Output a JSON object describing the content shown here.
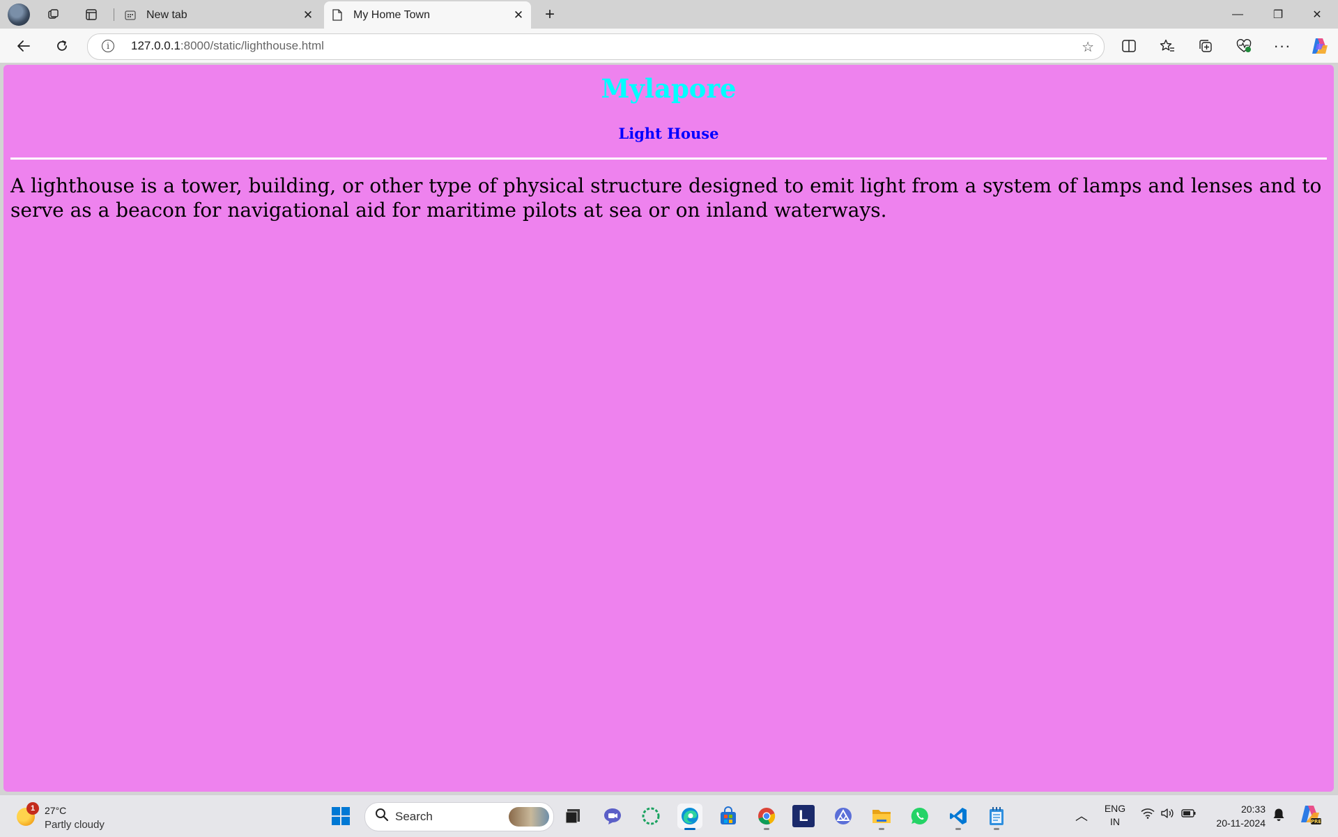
{
  "browser": {
    "tabs": [
      {
        "title": "New tab",
        "active": false
      },
      {
        "title": "My Home Town",
        "active": true
      }
    ],
    "new_tab_glyph": "+",
    "window_controls": {
      "minimize": "—",
      "restore": "❐",
      "close": "✕"
    },
    "address": {
      "host": "127.0.0.1",
      "rest": ":8000/static/lighthouse.html"
    },
    "icons": [
      "back-icon",
      "refresh-icon",
      "info-icon",
      "favorite-star-icon",
      "split-screen-icon",
      "favorites-icon",
      "collections-icon",
      "browser-essentials-icon",
      "more-icon",
      "copilot-icon"
    ]
  },
  "page": {
    "background": "#ee82ee",
    "heading": "Mylapore",
    "heading_color": "#00ffff",
    "subheading": "Light House",
    "subheading_color": "#0000ff",
    "paragraph": "A lighthouse is a tower, building, or other type of physical structure designed to emit light from a system of lamps and lenses and to serve as a beacon for navigational aid for maritime pilots at sea or on inland waterways."
  },
  "taskbar": {
    "weather": {
      "badge": "1",
      "temperature": "27°C",
      "condition": "Partly cloudy"
    },
    "search_label": "Search",
    "language": {
      "line1": "ENG",
      "line2": "IN"
    },
    "clock": {
      "time": "20:33",
      "date": "20-11-2024"
    },
    "pinned_apps": [
      "windows-start-icon",
      "search-icon",
      "file-manager-icon",
      "teams-meet-icon",
      "copilot-loader-icon",
      "edge-icon",
      "microsoft-store-icon",
      "chrome-icon",
      "l-app-icon",
      "affinity-icon",
      "file-explorer-icon",
      "whatsapp-icon",
      "vscode-icon",
      "notepad-icon"
    ]
  }
}
